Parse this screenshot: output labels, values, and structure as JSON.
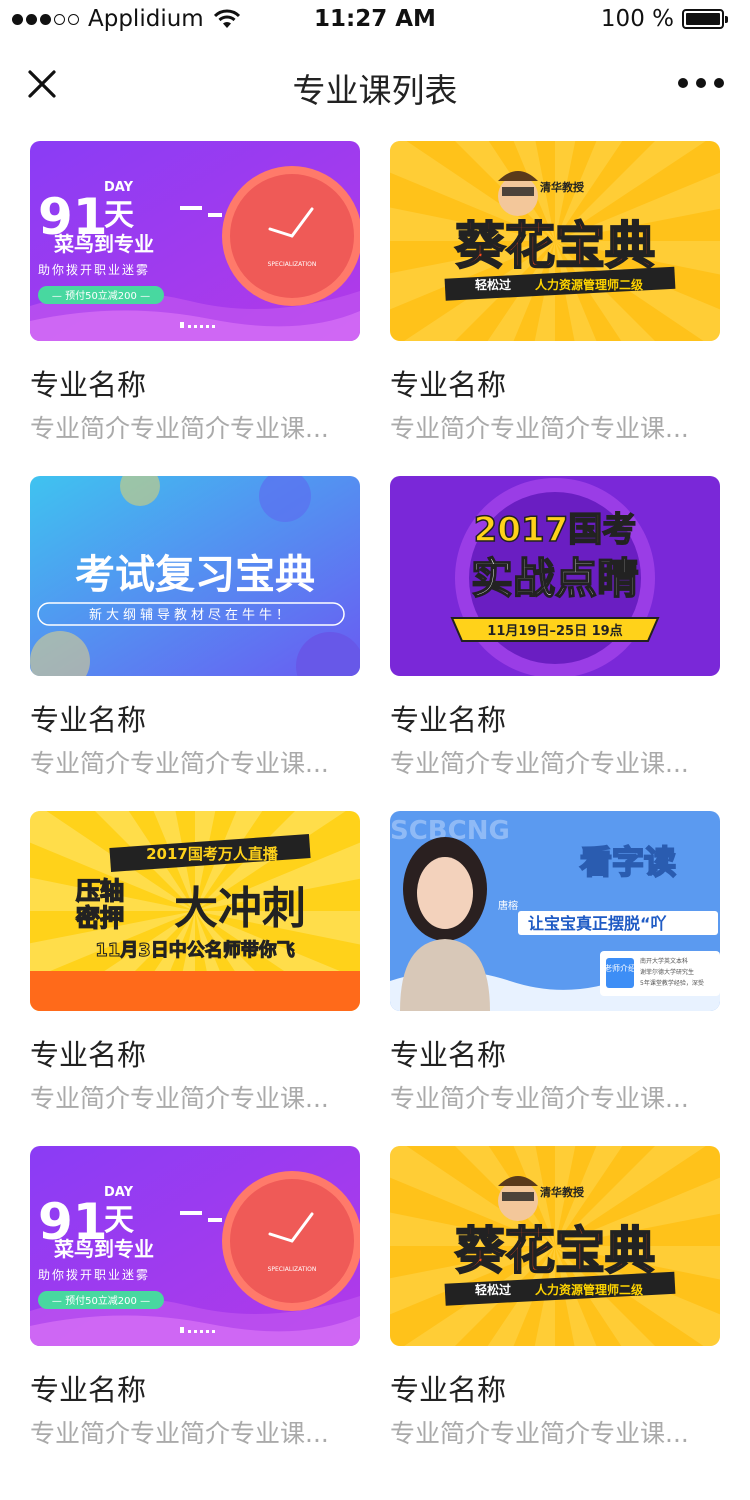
{
  "status_bar": {
    "carrier": "Applidium",
    "time": "11:27 AM",
    "battery": "100 %",
    "battery_level": 1.0,
    "signal_bars_filled": 3,
    "signal_bars_total": 5
  },
  "nav": {
    "title": "专业课列表",
    "close_icon": "close-icon",
    "more_icon": "more-icon"
  },
  "courses": [
    {
      "name": "专业名称",
      "desc": "专业简介专业简介专业课...",
      "banner": {
        "kind": "purple-clock",
        "big_number": "91",
        "day": "DAY",
        "tian": "天",
        "line1": "菜鸟到专业",
        "line2": "助你拨开职业迷雾",
        "pill": "— 预付50立减200 —",
        "clock_text": "SPECIALIZATION"
      }
    },
    {
      "name": "专业名称",
      "desc": "专业简介专业简介专业课...",
      "banner": {
        "kind": "yellow-baodian",
        "top": "清华教授",
        "main": "葵花宝典",
        "sub1": "轻松过",
        "sub2": "人力资源管理师二级"
      }
    },
    {
      "name": "专业名称",
      "desc": "专业简介专业简介专业课...",
      "banner": {
        "kind": "blue-review",
        "main": "考试复习宝典",
        "sub": "新大纲辅导教材尽在牛牛！"
      }
    },
    {
      "name": "专业名称",
      "desc": "专业简介专业简介专业课...",
      "banner": {
        "kind": "purple-exam",
        "line1": "2017国考",
        "line2": "实战点睛",
        "ribbon": "11月19日–25日 19点"
      }
    },
    {
      "name": "专业名称",
      "desc": "专业简介专业简介专业课...",
      "banner": {
        "kind": "yellow-live",
        "top": "2017国考万人直播",
        "left1": "压轴",
        "left2": "密押",
        "big": "大冲刺",
        "bottom": "11月3日中公名师带你飞"
      }
    },
    {
      "name": "专业名称",
      "desc": "专业简介专业简介专业课...",
      "banner": {
        "kind": "blue-teacher",
        "bg_letters": "SCBCNG",
        "side_text": "唐榕",
        "main": "看字读",
        "sub": "让宝宝真正摆脱“吖",
        "badge": "老师介绍",
        "info1": "南开大学英文本科",
        "info2": "谢菲尔德大学研究生",
        "info3": "5年课堂教学经验，深受"
      }
    },
    {
      "name": "专业名称",
      "desc": "专业简介专业简介专业课...",
      "banner": {
        "kind": "purple-clock",
        "big_number": "91",
        "day": "DAY",
        "tian": "天",
        "line1": "菜鸟到专业",
        "line2": "助你拨开职业迷雾",
        "pill": "— 预付50立减200 —",
        "clock_text": "SPECIALIZATION"
      }
    },
    {
      "name": "专业名称",
      "desc": "专业简介专业简介专业课...",
      "banner": {
        "kind": "yellow-baodian",
        "top": "清华教授",
        "main": "葵花宝典",
        "sub1": "轻松过",
        "sub2": "人力资源管理师二级"
      }
    }
  ],
  "colors": {
    "purple": "#7b3cf0",
    "magenta": "#a434e8",
    "yellow": "#ffc21a",
    "blue": "#3d8ef6",
    "red_clock": "#ef5a57"
  }
}
